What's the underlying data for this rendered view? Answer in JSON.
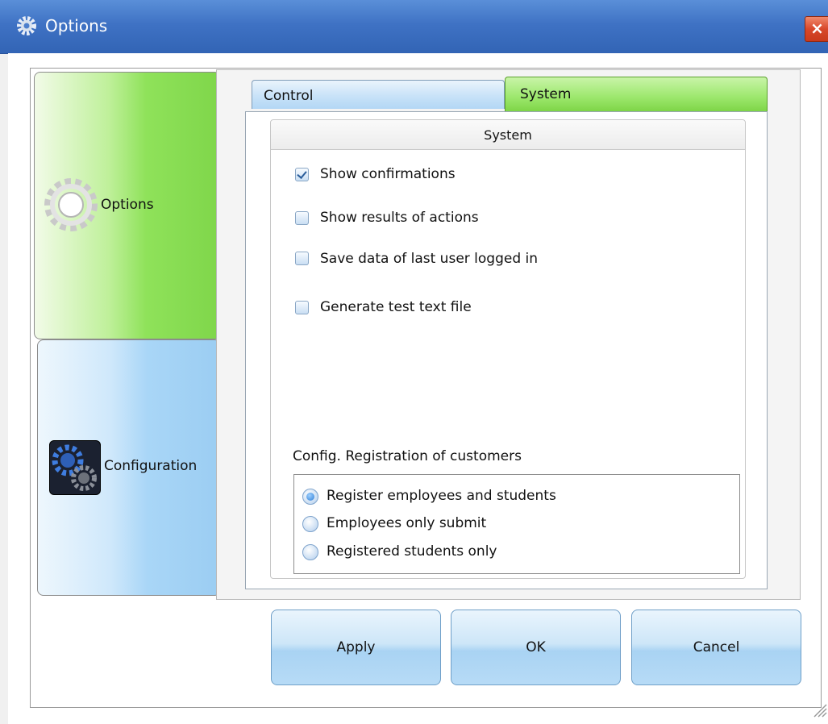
{
  "window": {
    "title": "Options",
    "close_glyph": "×"
  },
  "sidebar": {
    "items": [
      {
        "label": "Options",
        "icon": "gear-icon",
        "active": true
      },
      {
        "label": "Configuration",
        "icon": "config-gears-icon",
        "active": false
      }
    ]
  },
  "tabs": [
    {
      "label": "Control",
      "active": false
    },
    {
      "label": "System",
      "active": true
    }
  ],
  "system_group": {
    "title": "System",
    "checkboxes": [
      {
        "label": "Show confirmations",
        "checked": true
      },
      {
        "label": "Show results of actions",
        "checked": false
      },
      {
        "label": "Save data of last user logged in",
        "checked": false
      },
      {
        "label": "Generate test text file",
        "checked": false
      }
    ],
    "registration": {
      "label": "Config. Registration of customers",
      "options": [
        {
          "label": "Register employees and students",
          "selected": true
        },
        {
          "label": "Employees only submit",
          "selected": false
        },
        {
          "label": "Registered students only",
          "selected": false
        }
      ]
    }
  },
  "buttons": {
    "apply": "Apply",
    "ok": "OK",
    "cancel": "Cancel"
  },
  "colors": {
    "titlebar": "#3f72c4",
    "active_green": "#8fe25a",
    "inactive_blue": "#a9d6f7"
  }
}
